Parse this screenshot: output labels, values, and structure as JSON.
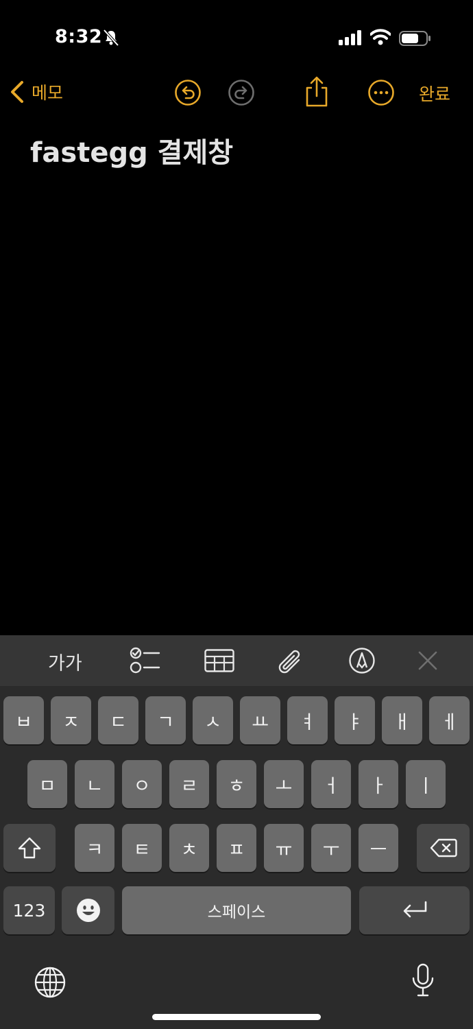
{
  "status_bar": {
    "time": "8:32"
  },
  "nav": {
    "back_label": "메모",
    "done_label": "완료"
  },
  "note": {
    "title": "fastegg 결제창"
  },
  "toolbar": {
    "format_label": "가가"
  },
  "keyboard": {
    "row1": [
      "ㅂ",
      "ㅈ",
      "ㄷ",
      "ㄱ",
      "ㅅ",
      "ㅛ",
      "ㅕ",
      "ㅑ",
      "ㅐ",
      "ㅔ"
    ],
    "row2": [
      "ㅁ",
      "ㄴ",
      "ㅇ",
      "ㄹ",
      "ㅎ",
      "ㅗ",
      "ㅓ",
      "ㅏ",
      "ㅣ"
    ],
    "row3": [
      "ㅋ",
      "ㅌ",
      "ㅊ",
      "ㅍ",
      "ㅠ",
      "ㅜ",
      "ㅡ"
    ],
    "numbers_label": "123",
    "space_label": "스페이스"
  },
  "colors": {
    "accent": "#e8a92a",
    "background": "#000000",
    "keyboard": "#2b2b2b",
    "key": "#6b6b6b"
  }
}
